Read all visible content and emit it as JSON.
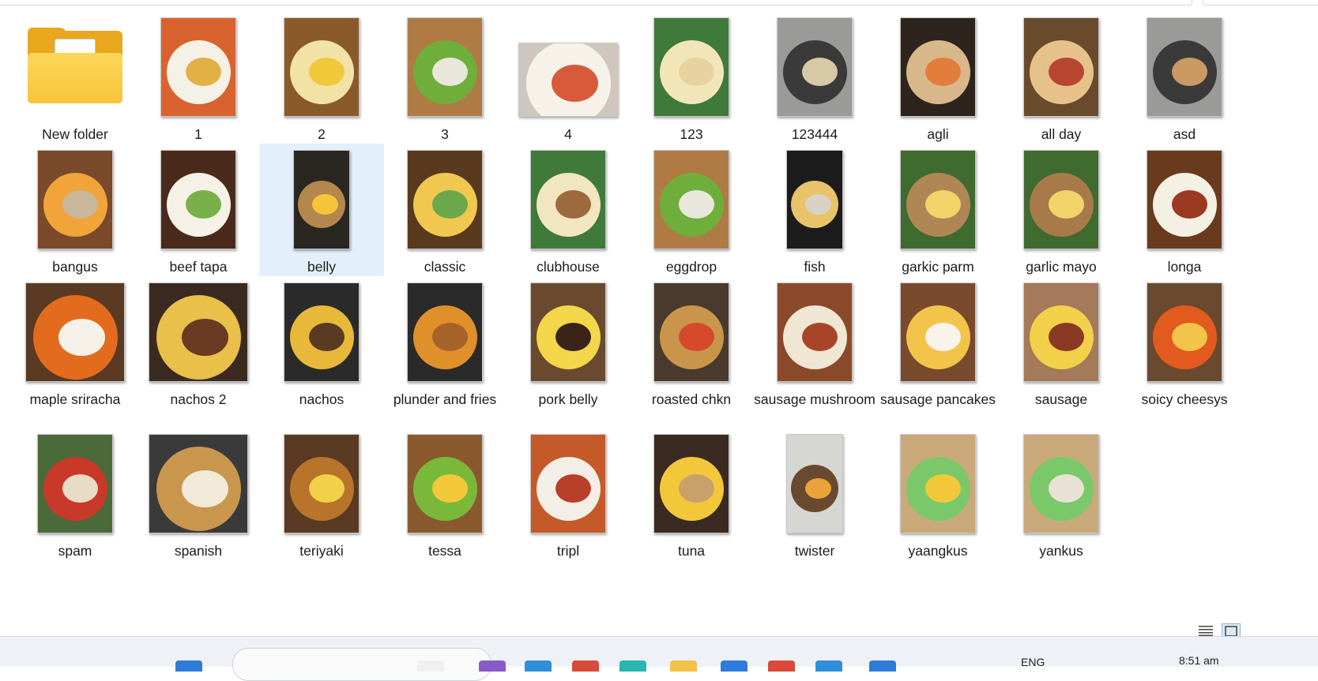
{
  "window": {
    "view_mode": "large icons",
    "selected_item": "belly"
  },
  "items": [
    {
      "name": "New folder",
      "type": "folder",
      "label_lines": 1
    },
    {
      "name": "1",
      "type": "image",
      "orient": "portrait",
      "colors": [
        "#d9632e",
        "#f4f1e6",
        "#e2b146"
      ]
    },
    {
      "name": "2",
      "type": "image",
      "orient": "portrait",
      "colors": [
        "#8b5a2b",
        "#f3e2a5",
        "#f0c93a"
      ]
    },
    {
      "name": "3",
      "type": "image",
      "orient": "portrait",
      "colors": [
        "#b07a44",
        "#6fae3a",
        "#e9e6dc"
      ]
    },
    {
      "name": "4",
      "type": "image",
      "orient": "landscape",
      "colors": [
        "#cfc7bd",
        "#f6f2ea",
        "#d75a3a"
      ]
    },
    {
      "name": "123",
      "type": "image",
      "orient": "portrait",
      "colors": [
        "#3f7a3b",
        "#f2e6b8",
        "#e8d2a0"
      ]
    },
    {
      "name": "123444",
      "type": "image",
      "orient": "portrait",
      "colors": [
        "#9a9a98",
        "#3a3a3a",
        "#d8c9a6"
      ]
    },
    {
      "name": "agli",
      "type": "image",
      "orient": "portrait",
      "colors": [
        "#2d241d",
        "#d8b88a",
        "#e27d3c"
      ]
    },
    {
      "name": "all day",
      "type": "image",
      "orient": "portrait",
      "colors": [
        "#6a4a2c",
        "#e6c189",
        "#b8452f"
      ]
    },
    {
      "name": "asd",
      "type": "image",
      "orient": "portrait",
      "colors": [
        "#9a9a98",
        "#3a3a3a",
        "#c99a64"
      ]
    },
    {
      "name": "bangus",
      "type": "image",
      "orient": "portrait",
      "colors": [
        "#7a4a2a",
        "#f0a43a",
        "#c8b79a"
      ]
    },
    {
      "name": "beef tapa",
      "type": "image",
      "orient": "portrait",
      "colors": [
        "#4a2a1a",
        "#f6f1e6",
        "#7ab04a"
      ]
    },
    {
      "name": "belly",
      "type": "image",
      "orient": "portrait-narrow",
      "colors": [
        "#2a2622",
        "#b4874e",
        "#f5c43a"
      ]
    },
    {
      "name": "classic",
      "type": "image",
      "orient": "portrait",
      "colors": [
        "#5a3a1e",
        "#f0c850",
        "#6aa84a"
      ]
    },
    {
      "name": "clubhouse",
      "type": "image",
      "orient": "portrait",
      "colors": [
        "#3f7a3b",
        "#f2e6c0",
        "#9c6a3c"
      ]
    },
    {
      "name": "eggdrop",
      "type": "image",
      "orient": "portrait",
      "colors": [
        "#b07a44",
        "#6fae3a",
        "#e9e6dc"
      ]
    },
    {
      "name": "fish",
      "type": "image",
      "orient": "portrait-narrow",
      "colors": [
        "#1c1c1c",
        "#e8c36a",
        "#d9d2c4"
      ]
    },
    {
      "name": "garkic parm",
      "type": "image",
      "orient": "portrait",
      "colors": [
        "#3f6a30",
        "#b08654",
        "#f2d36a"
      ]
    },
    {
      "name": "garlic mayo",
      "type": "image",
      "orient": "portrait",
      "colors": [
        "#3f6a30",
        "#a87a4a",
        "#f2d36a"
      ]
    },
    {
      "name": "longa",
      "type": "image",
      "orient": "portrait",
      "colors": [
        "#6a3a1e",
        "#f5f0e4",
        "#9a3a22"
      ]
    },
    {
      "name": "maple sriracha",
      "type": "image",
      "orient": "landscape",
      "colors": [
        "#5a3a22",
        "#e36b1e",
        "#f6f1e8"
      ]
    },
    {
      "name": "nachos 2",
      "type": "image",
      "orient": "landscape",
      "colors": [
        "#3a2a20",
        "#e8c04a",
        "#6a3a22"
      ]
    },
    {
      "name": "nachos",
      "type": "image",
      "orient": "portrait",
      "colors": [
        "#2a2a2a",
        "#e8b83a",
        "#5a3a22"
      ]
    },
    {
      "name": "plunder and fries",
      "type": "image",
      "orient": "portrait",
      "colors": [
        "#2a2a2a",
        "#e0902a",
        "#a6642a"
      ]
    },
    {
      "name": "pork belly",
      "type": "image",
      "orient": "portrait",
      "colors": [
        "#6a4a2e",
        "#f4d64a",
        "#3a2418"
      ]
    },
    {
      "name": "roasted chkn",
      "type": "image",
      "orient": "portrait",
      "colors": [
        "#4a3a2e",
        "#c8954a",
        "#d44a2a"
      ]
    },
    {
      "name": "sausage mushroom",
      "type": "image",
      "orient": "portrait",
      "colors": [
        "#8a4a2a",
        "#f0e6d4",
        "#a8442a"
      ]
    },
    {
      "name": "sausage pancakes",
      "type": "image",
      "orient": "portrait",
      "colors": [
        "#7a4a2e",
        "#f2c44a",
        "#f8f4ea"
      ]
    },
    {
      "name": "sausage",
      "type": "image",
      "orient": "portrait",
      "colors": [
        "#a47a5a",
        "#f2d04a",
        "#8a3a22"
      ]
    },
    {
      "name": "soicy cheesys",
      "type": "image",
      "orient": "portrait",
      "colors": [
        "#6a4a2e",
        "#e35a1e",
        "#f2c44a"
      ]
    },
    {
      "name": "spam",
      "type": "image",
      "orient": "portrait",
      "colors": [
        "#4a6a3a",
        "#c8392a",
        "#e8dcc6"
      ]
    },
    {
      "name": "spanish",
      "type": "image",
      "orient": "landscape",
      "colors": [
        "#3a3a3a",
        "#c9964e",
        "#f2ead8"
      ]
    },
    {
      "name": "teriyaki",
      "type": "image",
      "orient": "portrait",
      "colors": [
        "#5a3a22",
        "#b8742a",
        "#f2d04a"
      ]
    },
    {
      "name": "tessa",
      "type": "image",
      "orient": "portrait",
      "colors": [
        "#8a5a2e",
        "#7ab83a",
        "#f2c83a"
      ]
    },
    {
      "name": "tripl",
      "type": "image",
      "orient": "portrait",
      "colors": [
        "#c45a2a",
        "#f4efe6",
        "#b8402a"
      ]
    },
    {
      "name": "tuna",
      "type": "image",
      "orient": "portrait",
      "colors": [
        "#3a2a22",
        "#f2c83a",
        "#c9a06a"
      ]
    },
    {
      "name": "twister",
      "type": "image",
      "orient": "portrait-narrow",
      "colors": [
        "#d6d6d2",
        "#6a4a2e",
        "#e8a43a"
      ]
    },
    {
      "name": "yaangkus",
      "type": "image",
      "orient": "portrait",
      "colors": [
        "#c9a97a",
        "#7ac86a",
        "#f2c83a"
      ]
    },
    {
      "name": "yankus",
      "type": "image",
      "orient": "portrait",
      "colors": [
        "#c9a97a",
        "#7ac86a",
        "#e8e2d4"
      ]
    }
  ],
  "taskbar": {
    "language": "ENG",
    "time": "8:51 am",
    "icon_colors": [
      "#2f7bd9",
      "#f0f0f0",
      "#8a5ac8",
      "#2f8fd9",
      "#d84a3a",
      "#2ab5b0",
      "#f2c14a",
      "#2f7bd9",
      "#d84a3a",
      "#2f8fd9"
    ]
  },
  "status": {
    "details_view_icon": "list-lines-icon",
    "large_icons_view_icon": "square-icon"
  }
}
